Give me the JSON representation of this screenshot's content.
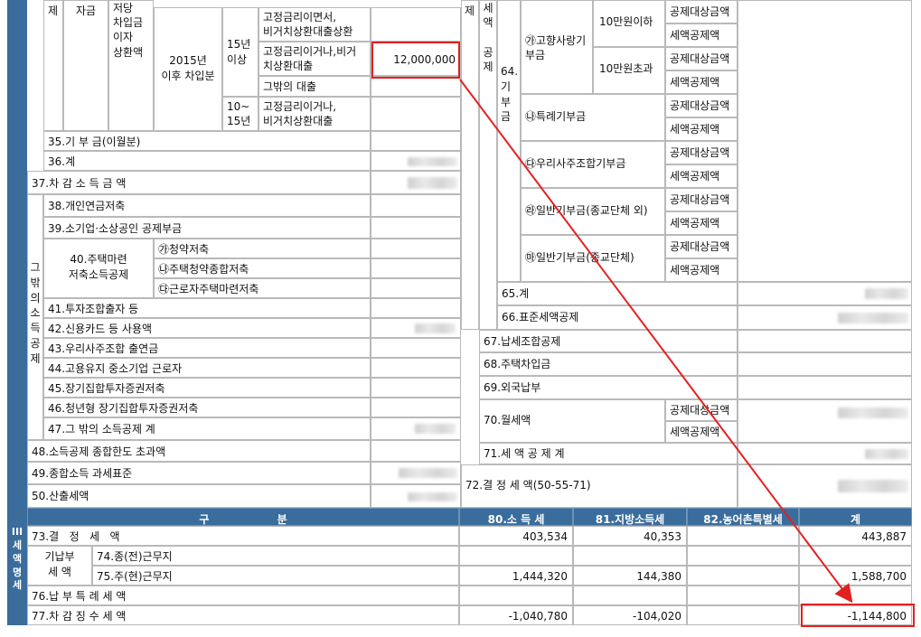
{
  "left": {
    "col_je": "제",
    "col_jagum": "자금",
    "col_mortgage": "저당\n차입금\n이자\n상환액",
    "since2015": "2015년\n이후 차입분",
    "y15plus": "15년\n이상",
    "y10to15": "10~\n15년",
    "sub_fixed_and_non": "고정금리이면서,\n비거치상환대출상환",
    "sub_fixed_or_non": "고정금리이거나,비거\n치상환대출",
    "sub_other_loan": "그밖의 대출",
    "sub_fixed_or_non_10": "고정금리이거나,\n비거치상환대출",
    "amount_fixed_or_non": "12,000,000",
    "r35": "35.기 부 금(이월분)",
    "r36": "36.계",
    "r37": "37.차 감 소 득 금 액",
    "group_other": "그\n밖\n의\n소\n득\n공\n제",
    "r38": "38.개인연금저축",
    "r39": "39.소기업·소상공인 공제부금",
    "r40": "40.주택마련\n저축소득공제",
    "r40a": "㉮청약저축",
    "r40b": "㉯주택청약종합저축",
    "r40c": "㉰근로자주택마련저축",
    "r41": "41.투자조합출자 등",
    "r42": "42.신용카드 등 사용액",
    "r43": "43.우리사주조합 출연금",
    "r44": "44.고용유지 중소기업 근로자",
    "r45": "45.장기집합투자증권저축",
    "r46": "46.청년형 장기집합투자증권저축",
    "r47": "47.그 밖의 소득공제 계",
    "r48": "48.소득공제 종합한도 초과액",
    "r49": "49.종합소득 과세표준",
    "r50": "50.산출세액"
  },
  "right": {
    "col_je": "제",
    "col_tax_credit": "세\n액\n\n공\n제",
    "col_64": "64.\n기\n부\n금",
    "hometown": "㉮고향사랑기\n부금",
    "under100k": "10만원이하",
    "over100k": "10만원초과",
    "special": "㉯특례기부금",
    "esop": "㉰우리사주조합기부금",
    "general_non_religious": "㉱일반기부금(종교단체 외)",
    "general_religious": "㉲일반기부금(종교단체)",
    "target_amount": "공제대상금액",
    "credit_amount": "세액공제액",
    "r65": "65.계",
    "r66": "66.표준세액공제",
    "r67": "67.납세조합공제",
    "r68": "68.주택차입금",
    "r69": "69.외국납부",
    "r70": "70.월세액",
    "r71": "71.세 액 공 제 계",
    "r72": "72.결 정 세 액(50-55-71)"
  },
  "bottom": {
    "section": "III\n세\n액\n명\n세",
    "h_gubun": "구                  분",
    "h_income": "80.소 득 세",
    "h_local": "81.지방소득세",
    "h_rural": "82.농어촌특별세",
    "h_total": "계",
    "rows": [
      {
        "label": "73.결   정   세   액",
        "income": "403,534",
        "local": "40,353",
        "rural": "",
        "total": "443,887"
      },
      {
        "label": "74.종(전)근무지",
        "income": "",
        "local": "",
        "rural": "",
        "total": ""
      },
      {
        "label": "75.주(현)근무지",
        "income": "1,444,320",
        "local": "144,380",
        "rural": "",
        "total": "1,588,700"
      },
      {
        "label": "76.납 부 특 례 세 액",
        "income": "",
        "local": "",
        "rural": "",
        "total": ""
      },
      {
        "label": "77.차 감 징 수 세 액",
        "income": "-1,040,780",
        "local": "-104,020",
        "rural": "",
        "total": "-1,144,800"
      }
    ],
    "prepaid_label": "기납부\n세  액"
  },
  "colors": {
    "header_blue": "#3a6d9c",
    "highlight_red": "#e32020"
  }
}
